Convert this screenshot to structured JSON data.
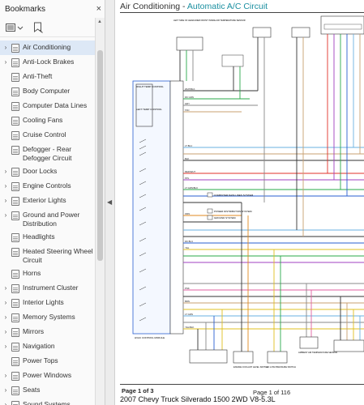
{
  "bookmarks_panel": {
    "title": "Bookmarks",
    "close_glyph": "×",
    "items": [
      {
        "label": "Air Conditioning",
        "expandable": true,
        "selected": true
      },
      {
        "label": "Anti-Lock Brakes",
        "expandable": true
      },
      {
        "label": "Anti-Theft",
        "expandable": false
      },
      {
        "label": "Body Computer",
        "expandable": false
      },
      {
        "label": "Computer Data Lines",
        "expandable": false
      },
      {
        "label": "Cooling Fans",
        "expandable": false
      },
      {
        "label": "Cruise Control",
        "expandable": false
      },
      {
        "label": "Defogger - Rear Defogger Circuit",
        "expandable": false
      },
      {
        "label": "Door Locks",
        "expandable": true
      },
      {
        "label": "Engine Controls",
        "expandable": true
      },
      {
        "label": "Exterior Lights",
        "expandable": true
      },
      {
        "label": "Ground and Power Distribution",
        "expandable": true
      },
      {
        "label": "Headlights",
        "expandable": false
      },
      {
        "label": "Heated Steering Wheel Circuit",
        "expandable": false
      },
      {
        "label": "Horns",
        "expandable": false
      },
      {
        "label": "Instrument Cluster",
        "expandable": true
      },
      {
        "label": "Interior Lights",
        "expandable": true
      },
      {
        "label": "Memory Systems",
        "expandable": true
      },
      {
        "label": "Mirrors",
        "expandable": true
      },
      {
        "label": "Navigation",
        "expandable": true
      },
      {
        "label": "Power Tops",
        "expandable": false
      },
      {
        "label": "Power Windows",
        "expandable": true
      },
      {
        "label": "Seats",
        "expandable": true
      },
      {
        "label": "Sound Systems",
        "expandable": true
      }
    ]
  },
  "document": {
    "title_part1": "Air Conditioning - ",
    "title_part2": "Automatic A/C Circuit",
    "footer_page_left": "Page 1 of 3",
    "footer_page_right": "Page 1 of 116",
    "footer_vehicle": "2007 Chevy Truck Silverado 1500 2WD V8-5.3L",
    "colors": {
      "title_accent": "#1a8fa0",
      "wire_red": "#e0302a",
      "wire_green": "#2aa84a",
      "wire_blue": "#2a5fd0",
      "wire_orange": "#e08a20",
      "wire_yellow": "#e0c020",
      "wire_purple": "#a040c0",
      "wire_pink": "#e060a0"
    }
  },
  "diagram": {
    "module_label": "HVAC CONTROL MODULE",
    "connector_labels": [
      "RIGHT TEMP CONTROL",
      "LEFT TEMP CONTROL",
      "MODE",
      "RECIRC",
      "BLOWER"
    ],
    "wire_labels": [
      "WHT/BLK",
      "DK GRN",
      "GRY",
      "TAN",
      "LT BLU",
      "BLK",
      "RED/WHT",
      "PPL",
      "LT GRN/BLK",
      "DK BLU",
      "ORN",
      "YEL",
      "BRN",
      "WHT",
      "PNK",
      "LT GRN",
      "YEL/BLK",
      "GRY/BLK"
    ],
    "notes": [
      "COMPUTER DATA LINES SYSTEM",
      "POWER DISTRIBUTION SYSTEM",
      "GROUND SYSTEM"
    ],
    "top_components": [
      "LEFT SIDE OF HEADLINER FRONT INSIDE AIR TEMPERATURE SENSOR",
      "UPPER LEFT AIR TEMPERATURE SENSOR",
      "UPPER RIGHT AIR TEMPERATURE SENSOR",
      "LOWER RIGHT SIDE OF DASH BLOWER MOTOR CONTROL"
    ],
    "bottom_components": [
      "ENGINE COOLANT LEVEL SWITCH",
      "A/C LOW PRESSURE SWITCH",
      "AMBIENT AIR TEMPERATURE SENSOR"
    ]
  }
}
